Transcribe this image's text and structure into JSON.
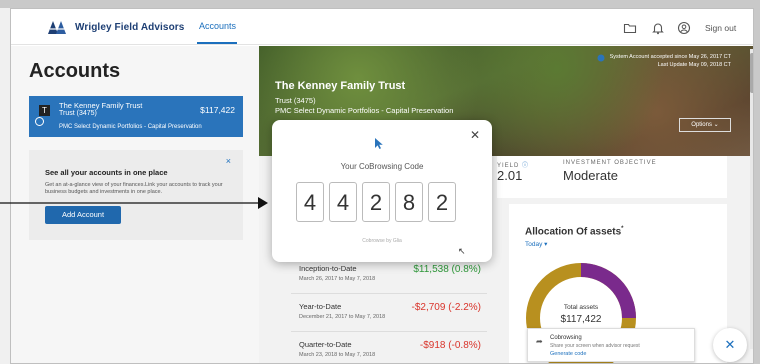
{
  "brand": {
    "name": "Wrigley Field Advisors",
    "logo_icon": "wf-logo-icon",
    "color": "#1e3f74"
  },
  "nav": {
    "accounts_label": "Accounts",
    "icons": [
      "folder-icon",
      "bell-icon",
      "user-icon"
    ],
    "signout_label": "Sign out",
    "accent": "#1b6fbd"
  },
  "left": {
    "title": "Accounts",
    "account": {
      "badge": "T",
      "name": "The Kenney Family Trust",
      "sub": "Trust (3475)",
      "strategy": "PMC Select Dynamic Portfolios - Capital Preservation",
      "value": "$117,422"
    },
    "promo": {
      "close": "×",
      "title": "See all your accounts in one place",
      "text": "Get an at-a-glance view of your finances.Link your accounts to track your business budgets and investments in one place.",
      "button": "Add Account"
    }
  },
  "hero": {
    "title": "The Kenney Family Trust",
    "sub": "Trust (3475)",
    "strategy": "PMC Select Dynamic Portfolios - Capital Preservation",
    "meta1": "System Account accepted since May 26, 2017 CT",
    "meta2": "Last Update May 09, 2018 CT",
    "options": "Options"
  },
  "stats": {
    "yield_label": "YIELD",
    "yield_value": "2.01",
    "objective_label": "INVESTMENT OBJECTIVE",
    "objective_value": "Moderate"
  },
  "performance": [
    {
      "label": "Inception-to-Date",
      "dates": "March 26, 2017 to May 7, 2018",
      "value": "$11,538 (0.8%)",
      "color": "#2f9a3a"
    },
    {
      "label": "Year-to-Date",
      "dates": "December 21, 2017 to May 7, 2018",
      "value": "-$2,709 (-2.2%)",
      "color": "#d9342b"
    },
    {
      "label": "Quarter-to-Date",
      "dates": "March 23, 2018 to May 7, 2018",
      "value": "-$918 (-0.8%)",
      "color": "#d9342b"
    }
  ],
  "allocation": {
    "title": "Allocation Of assets",
    "today": "Today",
    "total_label": "Total assets",
    "total_value": "$117,422",
    "colors": [
      "#b8901f",
      "#7a2a8c"
    ]
  },
  "toast": {
    "icon": "cobrowse-icon",
    "title": "Cobrowsing",
    "text": "Share your screen when advisor request",
    "link": "Generate code"
  },
  "fab_icon": "close-icon",
  "modal": {
    "title": "Your CoBrowsing Code",
    "digits": [
      "4",
      "4",
      "2",
      "8",
      "2"
    ],
    "powered": "Cobrowse by Glia"
  }
}
